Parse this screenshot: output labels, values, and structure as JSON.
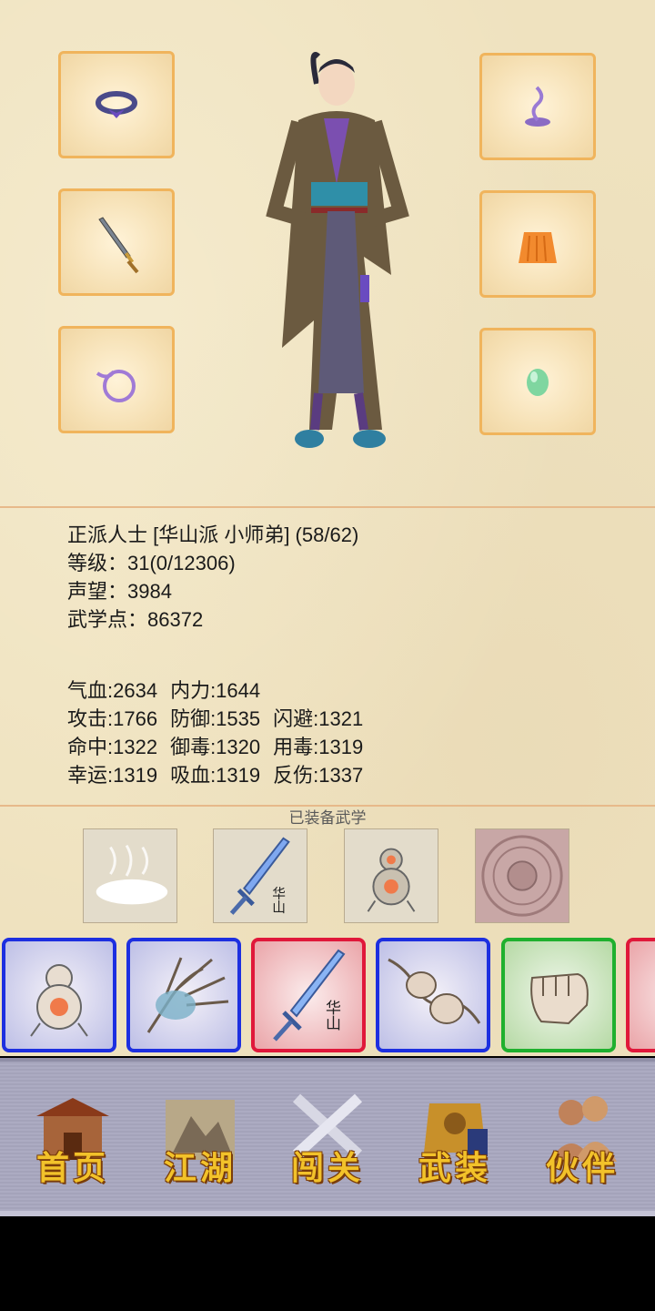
{
  "character": {
    "title_line": "正派人士 [华山派 小师弟] (58/62)",
    "level": "等级：31(0/12306)",
    "reputation": "声望：3984",
    "martial_points": "武学点：86372"
  },
  "stats": {
    "row1": [
      "气血:2634",
      "内力:1644"
    ],
    "row2": [
      "攻击:1766",
      "防御:1535",
      "闪避:1321"
    ],
    "row3": [
      "命中:1322",
      "御毒:1320",
      "用毒:1319"
    ],
    "row4": [
      "幸运:1319",
      "吸血:1319",
      "反伤:1337"
    ]
  },
  "equipment": {
    "left": [
      "ring-icon",
      "sword-icon",
      "bracelet-icon"
    ],
    "right": [
      "incense-icon",
      "skirt-icon",
      "jade-icon"
    ]
  },
  "equipped_martial": {
    "title": "已装备武学",
    "sword_label": "华山",
    "items": [
      "mist-icon",
      "huashan-sword-icon",
      "gourd-icon",
      "seal-icon"
    ]
  },
  "skill_cards": {
    "sword_label": "华山",
    "items": [
      {
        "icon": "gourd-icon",
        "rarity": "blue"
      },
      {
        "icon": "palm-icon",
        "rarity": "blue"
      },
      {
        "icon": "huashan-sword-icon",
        "rarity": "red"
      },
      {
        "icon": "fists-icon",
        "rarity": "blue"
      },
      {
        "icon": "fist-icon",
        "rarity": "green"
      },
      {
        "icon": "partial-card",
        "rarity": "red"
      }
    ]
  },
  "nav": {
    "home": "首页",
    "jianghu": "江湖",
    "challenge": "闯关",
    "armory": "武装",
    "partner": "伙伴"
  },
  "colors": {
    "parchment": "#efe2bf",
    "slot_border": "#f0b45c",
    "blue_rarity": "#1d2fe0",
    "red_rarity": "#e0183a",
    "green_rarity": "#1fb02e",
    "nav_text": "#f2c22a",
    "nav_bg": "#a9a8c0"
  }
}
